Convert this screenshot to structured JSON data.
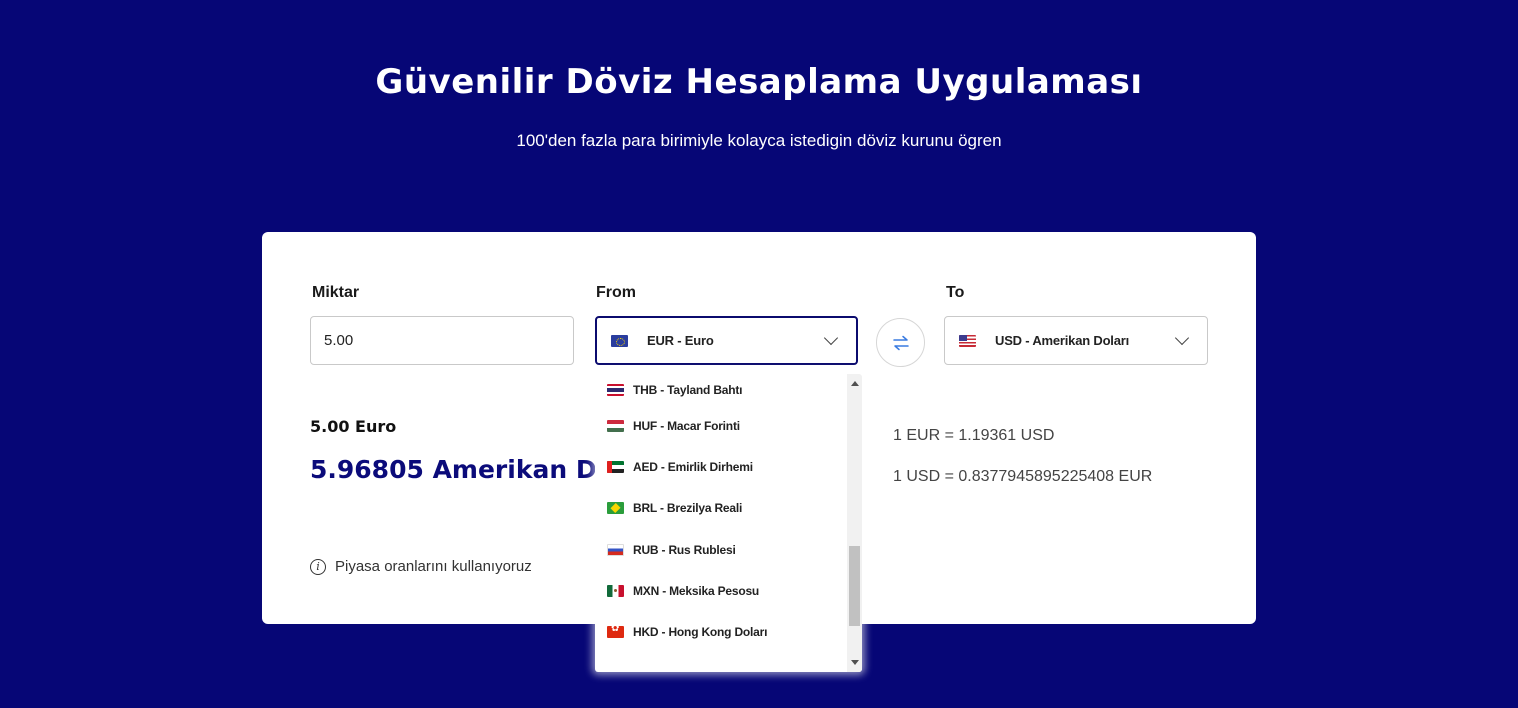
{
  "hero": {
    "title": "Güvenilir Döviz Hesaplama Uygulaması",
    "subtitle": "100'den fazla para birimiyle kolayca istedigin döviz kurunu ögren"
  },
  "converter": {
    "amount_label": "Miktar",
    "amount_value": "5.00",
    "from_label": "From",
    "from_selected": "EUR - Euro",
    "to_label": "To",
    "to_selected": "USD - Amerikan Doları",
    "from_amount_text": "5.00 Euro",
    "result_text": "5.96805 Amerikan Doları",
    "rate_forward": "1 EUR = 1.19361 USD",
    "rate_reverse": "1 USD = 0.8377945895225408 EUR",
    "disclaimer": "Piyasa oranlarını kullanıyoruz"
  },
  "dropdown": {
    "items": [
      {
        "label": "THB - Tayland Bahtı",
        "flag": "flag-th"
      },
      {
        "label": "HUF - Macar Forinti",
        "flag": "flag-hu"
      },
      {
        "label": "AED - Emirlik Dirhemi",
        "flag": "flag-ae"
      },
      {
        "label": "BRL - Brezilya Reali",
        "flag": "flag-br"
      },
      {
        "label": "RUB - Rus Rublesi",
        "flag": "flag-ru"
      },
      {
        "label": "MXN - Meksika Pesosu",
        "flag": "flag-mx"
      },
      {
        "label": "HKD - Hong Kong Doları",
        "flag": "flag-hk"
      }
    ]
  },
  "colors": {
    "background": "#060676",
    "accent": "#0b0b7a",
    "swap_icon": "#3a7be0"
  },
  "icons": {
    "swap": "swap-arrows-icon",
    "info": "info-icon",
    "chevron": "chevron-down-icon"
  }
}
